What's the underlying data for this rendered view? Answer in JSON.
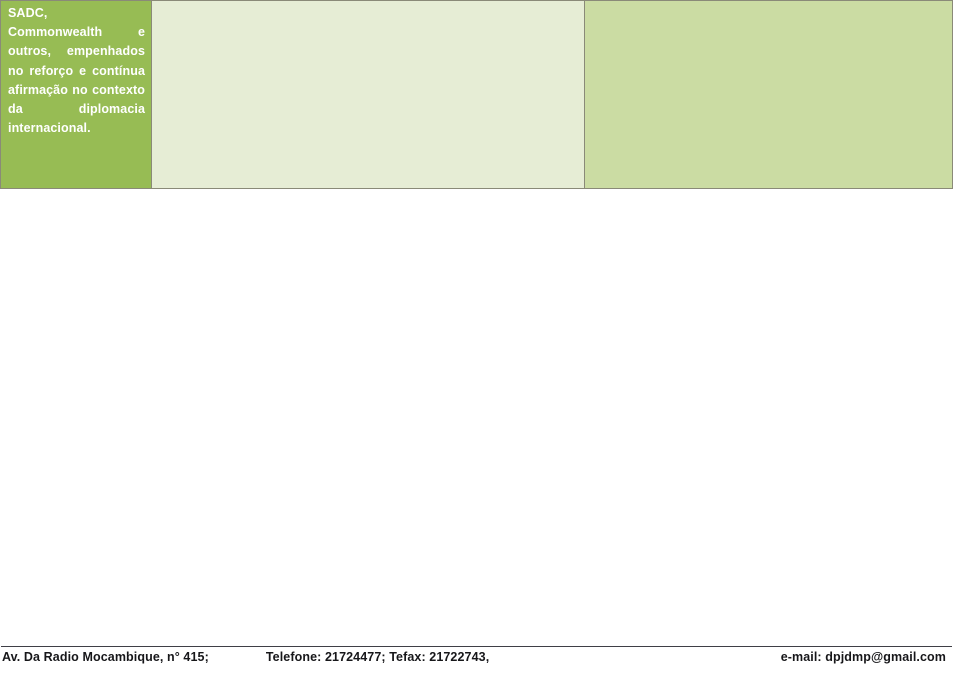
{
  "document": {
    "table": {
      "rows": [
        {
          "cells": [
            {
              "name": "institutions-cell",
              "style": "accent",
              "text": "SADC, Commonwealth e outros, empenhados no reforço e contínua afirmação no contexto da diplomacia",
              "last_line": "internacional."
            },
            {
              "name": "middle-cell",
              "style": "pale",
              "text": "",
              "last_line": ""
            },
            {
              "name": "right-cell",
              "style": "mid",
              "text": "",
              "last_line": ""
            }
          ]
        }
      ]
    },
    "footer": {
      "address": "Av. Da Radio Mocambique, n° 415;",
      "phone": "Telefone: 21724477; Tefax: 21722743,",
      "email": "e-mail: dpjdmp@gmail.com"
    }
  },
  "colors": {
    "accent_green": "#97bc54",
    "pale_green": "#e6edd5",
    "mid_green": "#cbdca3",
    "cell_border": "#8a8a78",
    "footer_rule": "#3f3f46",
    "cell_text": "#ffffff",
    "footer_text": "#17171a"
  }
}
